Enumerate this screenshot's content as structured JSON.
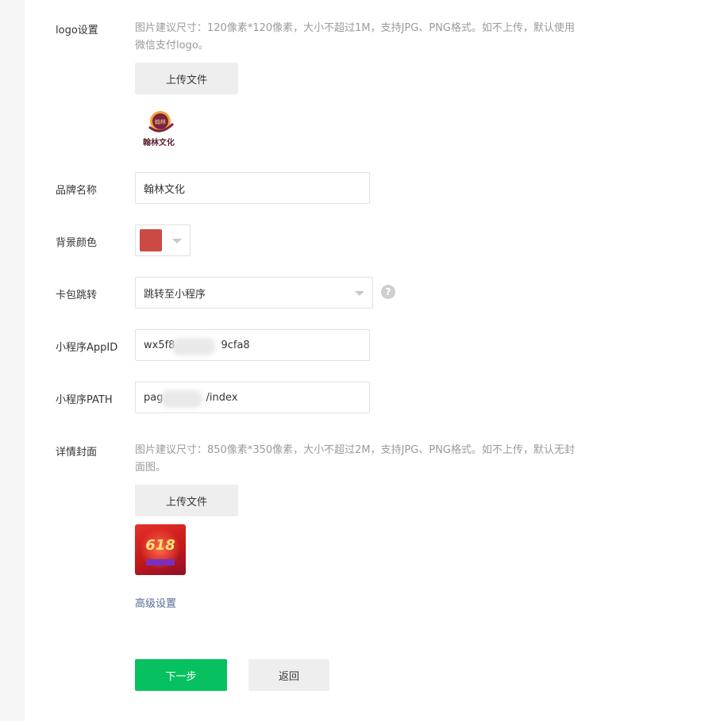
{
  "logo": {
    "label": "logo设置",
    "hint": "图片建议尺寸：120像素*120像素，大小不超过1M，支持JPG、PNG格式。如不上传，默认使用微信支付logo。",
    "upload_label": "上传文件",
    "brand_text": "翰林文化",
    "badge_text": "翰林"
  },
  "brand_name": {
    "label": "品牌名称",
    "value": "翰林文化"
  },
  "bg_color": {
    "label": "背景颜色",
    "value": "#cc4a44"
  },
  "card_jump": {
    "label": "卡包跳转",
    "selected": "跳转至小程序"
  },
  "appid": {
    "label": "小程序AppID",
    "value_prefix": "wx5f8",
    "value_suffix": "9cfa8"
  },
  "path": {
    "label": "小程序PATH",
    "value_prefix": "pag",
    "value_suffix": "/index"
  },
  "cover": {
    "label": "详情封面",
    "hint": "图片建议尺寸：850像素*350像素，大小不超过2M，支持JPG、PNG格式。如不上传，默认无封面图。",
    "upload_label": "上传文件",
    "thumb_text": "618"
  },
  "advanced_link": "高级设置",
  "buttons": {
    "next": "下一步",
    "back": "返回"
  },
  "colors": {
    "primary": "#07c160",
    "link": "#576b95",
    "hint": "#9a9a9a"
  }
}
